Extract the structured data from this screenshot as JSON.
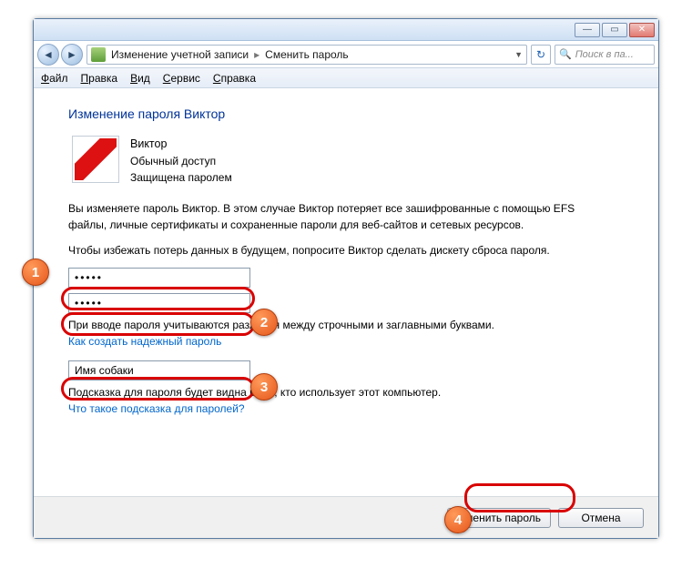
{
  "titlebar": {
    "minimize": "—",
    "maximize": "▭",
    "close": "✕"
  },
  "breadcrumb": {
    "part1": "Изменение учетной записи",
    "part2": "Сменить пароль",
    "sep": "▸"
  },
  "search": {
    "placeholder": "Поиск в па..."
  },
  "menu": {
    "file": "Файл",
    "edit": "Правка",
    "view": "Вид",
    "tools": "Сервис",
    "help": "Справка"
  },
  "heading": "Изменение пароля Виктор",
  "user": {
    "name": "Виктор",
    "access": "Обычный доступ",
    "protected": "Защищена паролем"
  },
  "desc1": "Вы изменяете пароль Виктор. В этом случае Виктор потеряет все зашифрованные с помощью EFS файлы, личные сертификаты и сохраненные пароли для веб-сайтов и сетевых ресурсов.",
  "desc2": "Чтобы избежать потерь данных в будущем, попросите Виктор сделать дискету сброса пароля.",
  "fields": {
    "password1": "●●●●●",
    "password2": "●●●●●",
    "hint_value": "Имя собаки"
  },
  "notes": {
    "case": "При вводе пароля учитываются различия между строчными и заглавными буквами.",
    "link1": "Как создать надежный пароль",
    "hint_note": "Подсказка для пароля будет видна всем, кто использует этот компьютер.",
    "link2": "Что такое подсказка для паролей?"
  },
  "buttons": {
    "submit": "Сменить пароль",
    "cancel": "Отмена"
  },
  "annotations": {
    "b1": "1",
    "b2": "2",
    "b3": "3",
    "b4": "4"
  }
}
